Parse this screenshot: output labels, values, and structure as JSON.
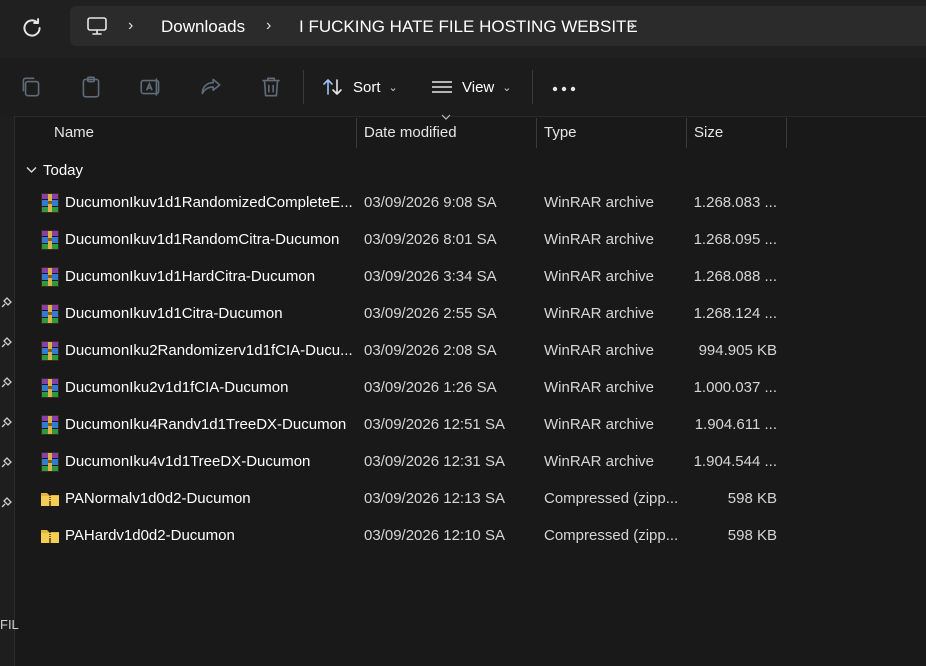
{
  "address_bar": {
    "breadcrumbs": [
      "Downloads",
      "I FUCKING HATE FILE HOSTING WEBSITE"
    ]
  },
  "command_bar": {
    "sort_label": "Sort",
    "view_label": "View"
  },
  "columns": {
    "name": "Name",
    "date": "Date modified",
    "type": "Type",
    "size": "Size"
  },
  "group": {
    "label": "Today"
  },
  "files": [
    {
      "name": "DucumonIkuv1d1RandomizedCompleteE...",
      "date": "03/09/2026 9:08 SA",
      "type": "WinRAR archive",
      "size": "1.268.083 ...",
      "icon": "winrar-icon"
    },
    {
      "name": "DucumonIkuv1d1RandomCitra-Ducumon",
      "date": "03/09/2026 8:01 SA",
      "type": "WinRAR archive",
      "size": "1.268.095 ...",
      "icon": "winrar-icon"
    },
    {
      "name": "DucumonIkuv1d1HardCitra-Ducumon",
      "date": "03/09/2026 3:34 SA",
      "type": "WinRAR archive",
      "size": "1.268.088 ...",
      "icon": "winrar-icon"
    },
    {
      "name": "DucumonIkuv1d1Citra-Ducumon",
      "date": "03/09/2026 2:55 SA",
      "type": "WinRAR archive",
      "size": "1.268.124 ...",
      "icon": "winrar-icon"
    },
    {
      "name": "DucumonIku2Randomizerv1d1fCIA-Ducu...",
      "date": "03/09/2026 2:08 SA",
      "type": "WinRAR archive",
      "size": "994.905 KB",
      "icon": "winrar-icon"
    },
    {
      "name": "DucumonIku2v1d1fCIA-Ducumon",
      "date": "03/09/2026 1:26 SA",
      "type": "WinRAR archive",
      "size": "1.000.037 ...",
      "icon": "winrar-icon"
    },
    {
      "name": "DucumonIku4Randv1d1TreeDX-Ducumon",
      "date": "03/09/2026 12:51 SA",
      "type": "WinRAR archive",
      "size": "1.904.611 ...",
      "icon": "winrar-icon"
    },
    {
      "name": "DucumonIku4v1d1TreeDX-Ducumon",
      "date": "03/09/2026 12:31 SA",
      "type": "WinRAR archive",
      "size": "1.904.544 ...",
      "icon": "winrar-icon"
    },
    {
      "name": "PANormalv1d0d2-Ducumon",
      "date": "03/09/2026 12:13 SA",
      "type": "Compressed (zipp...",
      "size": "598 KB",
      "icon": "zip-folder-icon"
    },
    {
      "name": "PAHardv1d0d2-Ducumon",
      "date": "03/09/2026 12:10 SA",
      "type": "Compressed (zipp...",
      "size": "598 KB",
      "icon": "zip-folder-icon"
    }
  ],
  "nav_strip": {
    "partial_label": "FIL"
  },
  "colors": {
    "background": "#191919",
    "address_bg": "#2b2b2b",
    "text": "#ffffff",
    "secondary_text": "#d6d6d6",
    "accent_blue": "#9cc4f2"
  }
}
